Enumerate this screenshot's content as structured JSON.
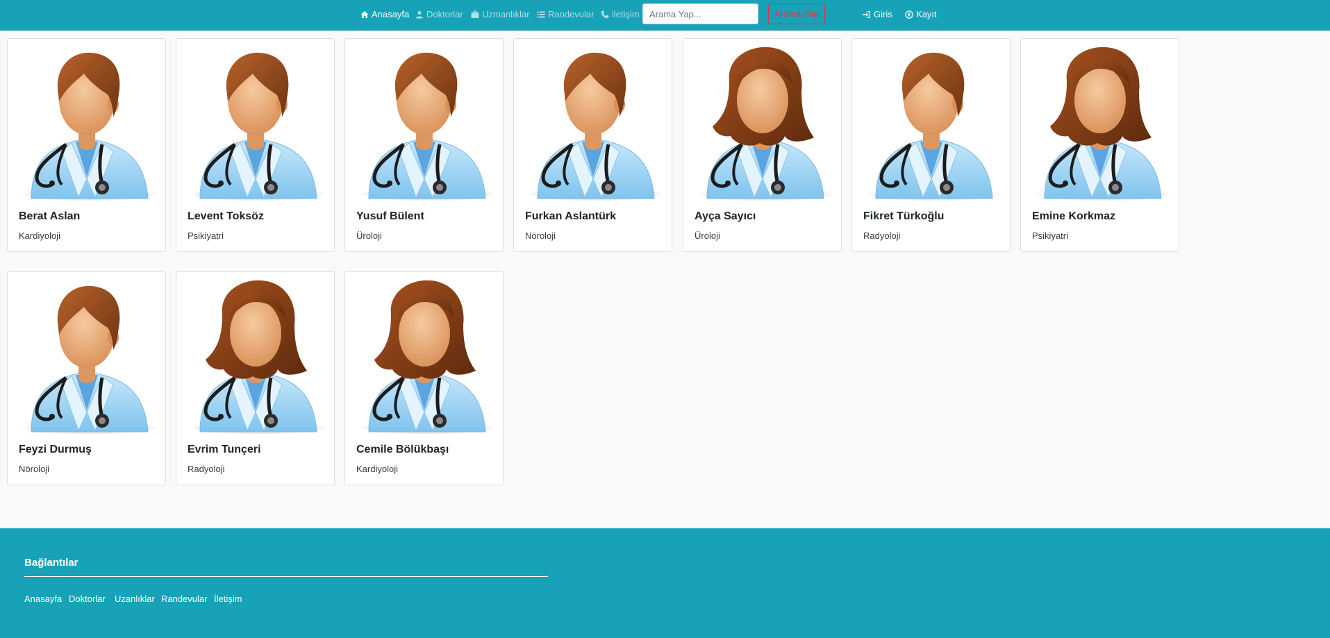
{
  "navbar": {
    "links": [
      {
        "label": "Anasayfa",
        "icon": "home-icon",
        "active": true
      },
      {
        "label": "Doktorlar",
        "icon": "user-icon",
        "active": false
      },
      {
        "label": "Uzmanlıklar",
        "icon": "briefcase-icon",
        "active": false
      },
      {
        "label": "Randevular",
        "icon": "list-icon",
        "active": false
      },
      {
        "label": "iletişim",
        "icon": "phone-icon",
        "active": false
      }
    ],
    "search": {
      "placeholder": "Arama Yap...",
      "value": "",
      "button_label": "Arama Yap"
    },
    "auth": [
      {
        "label": "Giris",
        "icon": "sign-in-icon"
      },
      {
        "label": "Kayıt",
        "icon": "registered-icon"
      }
    ]
  },
  "doctors": [
    {
      "name": "Berat Aslan",
      "specialty": "Kardiyoloji",
      "avatar": "male-doctor-icon"
    },
    {
      "name": "Levent Toksöz",
      "specialty": "Psikiyatri",
      "avatar": "male-doctor-icon"
    },
    {
      "name": "Yusuf Bülent",
      "specialty": "Üroloji",
      "avatar": "male-doctor-icon"
    },
    {
      "name": "Furkan Aslantürk",
      "specialty": "Nöroloji",
      "avatar": "male-doctor-icon"
    },
    {
      "name": "Ayça Sayıcı",
      "specialty": "Üroloji",
      "avatar": "female-doctor-icon"
    },
    {
      "name": "Fikret Türkoğlu",
      "specialty": "Radyoloji",
      "avatar": "male-doctor-icon"
    },
    {
      "name": "Emine Korkmaz",
      "specialty": "Psikiyatri",
      "avatar": "female-doctor-icon"
    },
    {
      "name": "Feyzi Durmuş",
      "specialty": "Nöroloji",
      "avatar": "male-doctor-icon"
    },
    {
      "name": "Evrim Tunçeri",
      "specialty": "Radyoloji",
      "avatar": "female-doctor-icon"
    },
    {
      "name": "Cemile Bölükbaşı",
      "specialty": "Kardiyoloji",
      "avatar": "female-doctor-icon"
    }
  ],
  "footer": {
    "title": "Bağlantılar",
    "links": [
      "Anasayfa",
      "Doktorlar",
      "Uzanlıklar",
      "Randevular",
      "İletişim"
    ]
  },
  "colors": {
    "navbar": "#17a2b8",
    "footer": "#17a2b8",
    "search_button": "#dc3545",
    "background": "#f8f9fa"
  }
}
